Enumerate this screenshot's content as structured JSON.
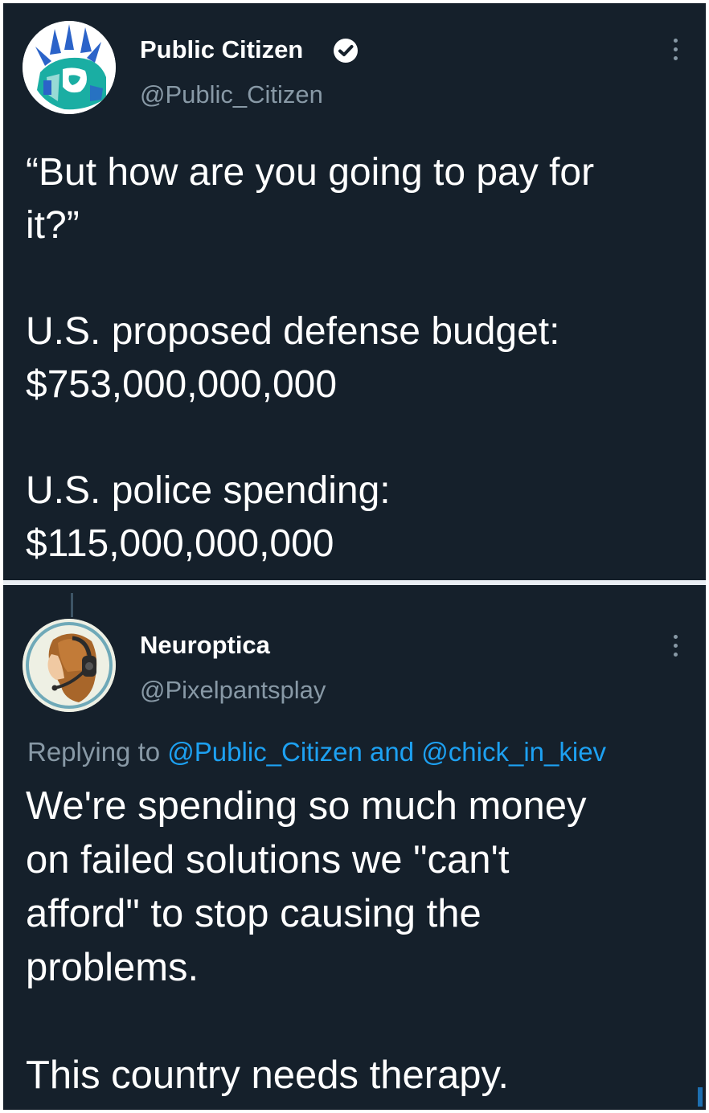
{
  "main_tweet": {
    "display_name": "Public Citizen",
    "handle": "@Public_Citizen",
    "verified_icon": "verified-badge-icon",
    "avatar_icon": "statue-of-liberty-logo",
    "text_lines": [
      "“But how are you going to pay for",
      "it?”",
      "",
      "U.S. proposed defense budget:",
      "$753,000,000,000",
      "",
      "U.S. police spending:",
      "$115,000,000,000"
    ]
  },
  "reply_tweet": {
    "display_name": "Neuroptica",
    "handle": "@Pixelpantsplay",
    "avatar_icon": "headset-portrait-avatar",
    "replying_prefix": "Replying to ",
    "replying_mention_1": "@Public_Citizen",
    "replying_and": " and ",
    "replying_mention_2": "@chick_in_kiev",
    "text_lines": [
      "We're spending so much money",
      "on failed solutions we \"can't",
      "afford\" to stop causing the",
      "problems.",
      "",
      "This country needs therapy."
    ]
  },
  "colors": {
    "background": "#15202b",
    "text": "#ffffff",
    "secondary_text": "#8899a6",
    "mention": "#1da1f2",
    "brand_teal": "#1aaea3"
  }
}
